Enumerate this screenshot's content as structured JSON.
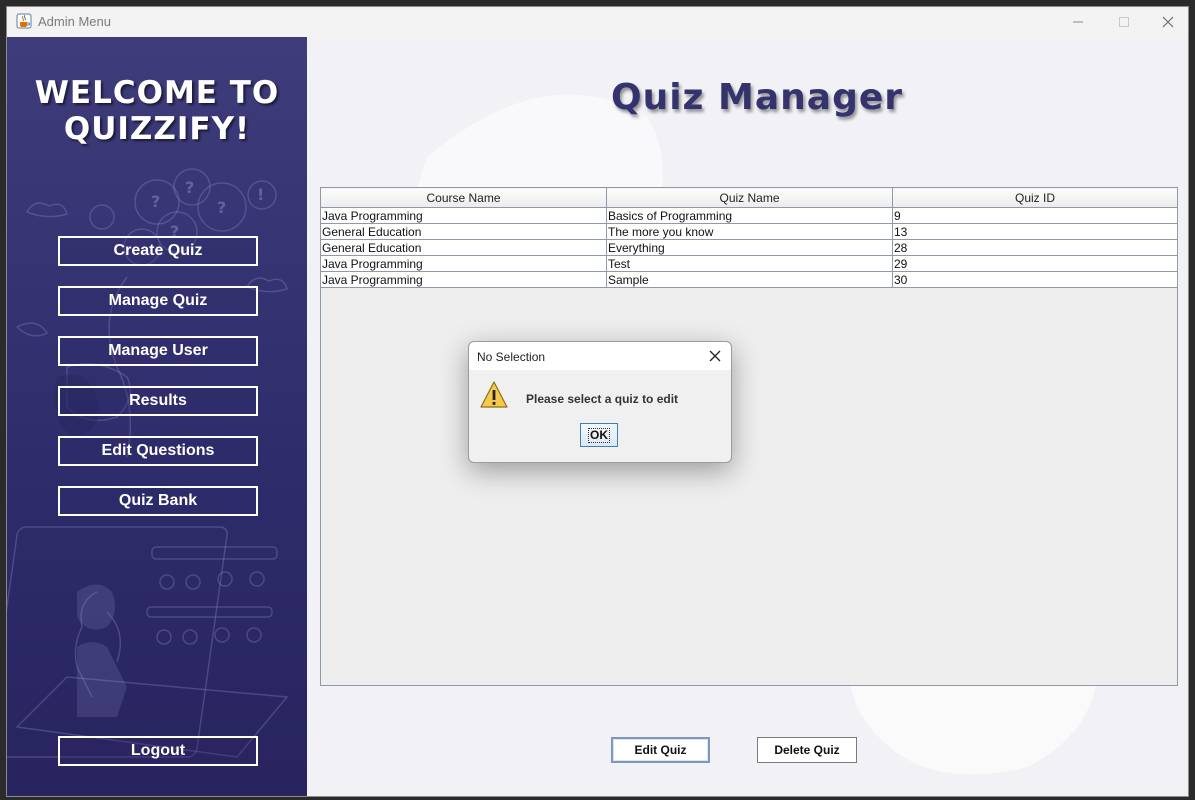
{
  "window": {
    "title": "Admin Menu",
    "icons": {
      "app": "java-cup-icon",
      "minimize": "minimize-icon",
      "maximize": "maximize-icon",
      "close": "close-icon"
    }
  },
  "sidebar": {
    "welcome": "WELCOME TO\nQUIZZIFY!",
    "menu": [
      {
        "label": "Create Quiz"
      },
      {
        "label": "Manage Quiz"
      },
      {
        "label": "Manage User"
      },
      {
        "label": "Results"
      },
      {
        "label": "Edit Questions"
      },
      {
        "label": "Quiz Bank"
      }
    ],
    "logout": "Logout",
    "colors": {
      "top": "#3e3c7a",
      "bottom": "#27245f",
      "button_border": "#ffffff"
    }
  },
  "main": {
    "title": "Quiz Manager",
    "table": {
      "columns": [
        "Course Name",
        "Quiz Name",
        "Quiz ID"
      ],
      "rows": [
        [
          "Java Programming",
          "Basics of Programming",
          "9"
        ],
        [
          "General Education",
          "The more you know",
          "13"
        ],
        [
          "General Education",
          "Everything",
          "28"
        ],
        [
          "Java Programming",
          "Test",
          "29"
        ],
        [
          "Java Programming",
          "Sample",
          "30"
        ]
      ]
    },
    "buttons": {
      "edit": "Edit Quiz",
      "delete": "Delete Quiz"
    },
    "colors": {
      "title": "#35336e"
    }
  },
  "dialog": {
    "title": "No Selection",
    "message": "Please select a quiz to edit",
    "ok": "OK",
    "icon": "warning-icon"
  }
}
